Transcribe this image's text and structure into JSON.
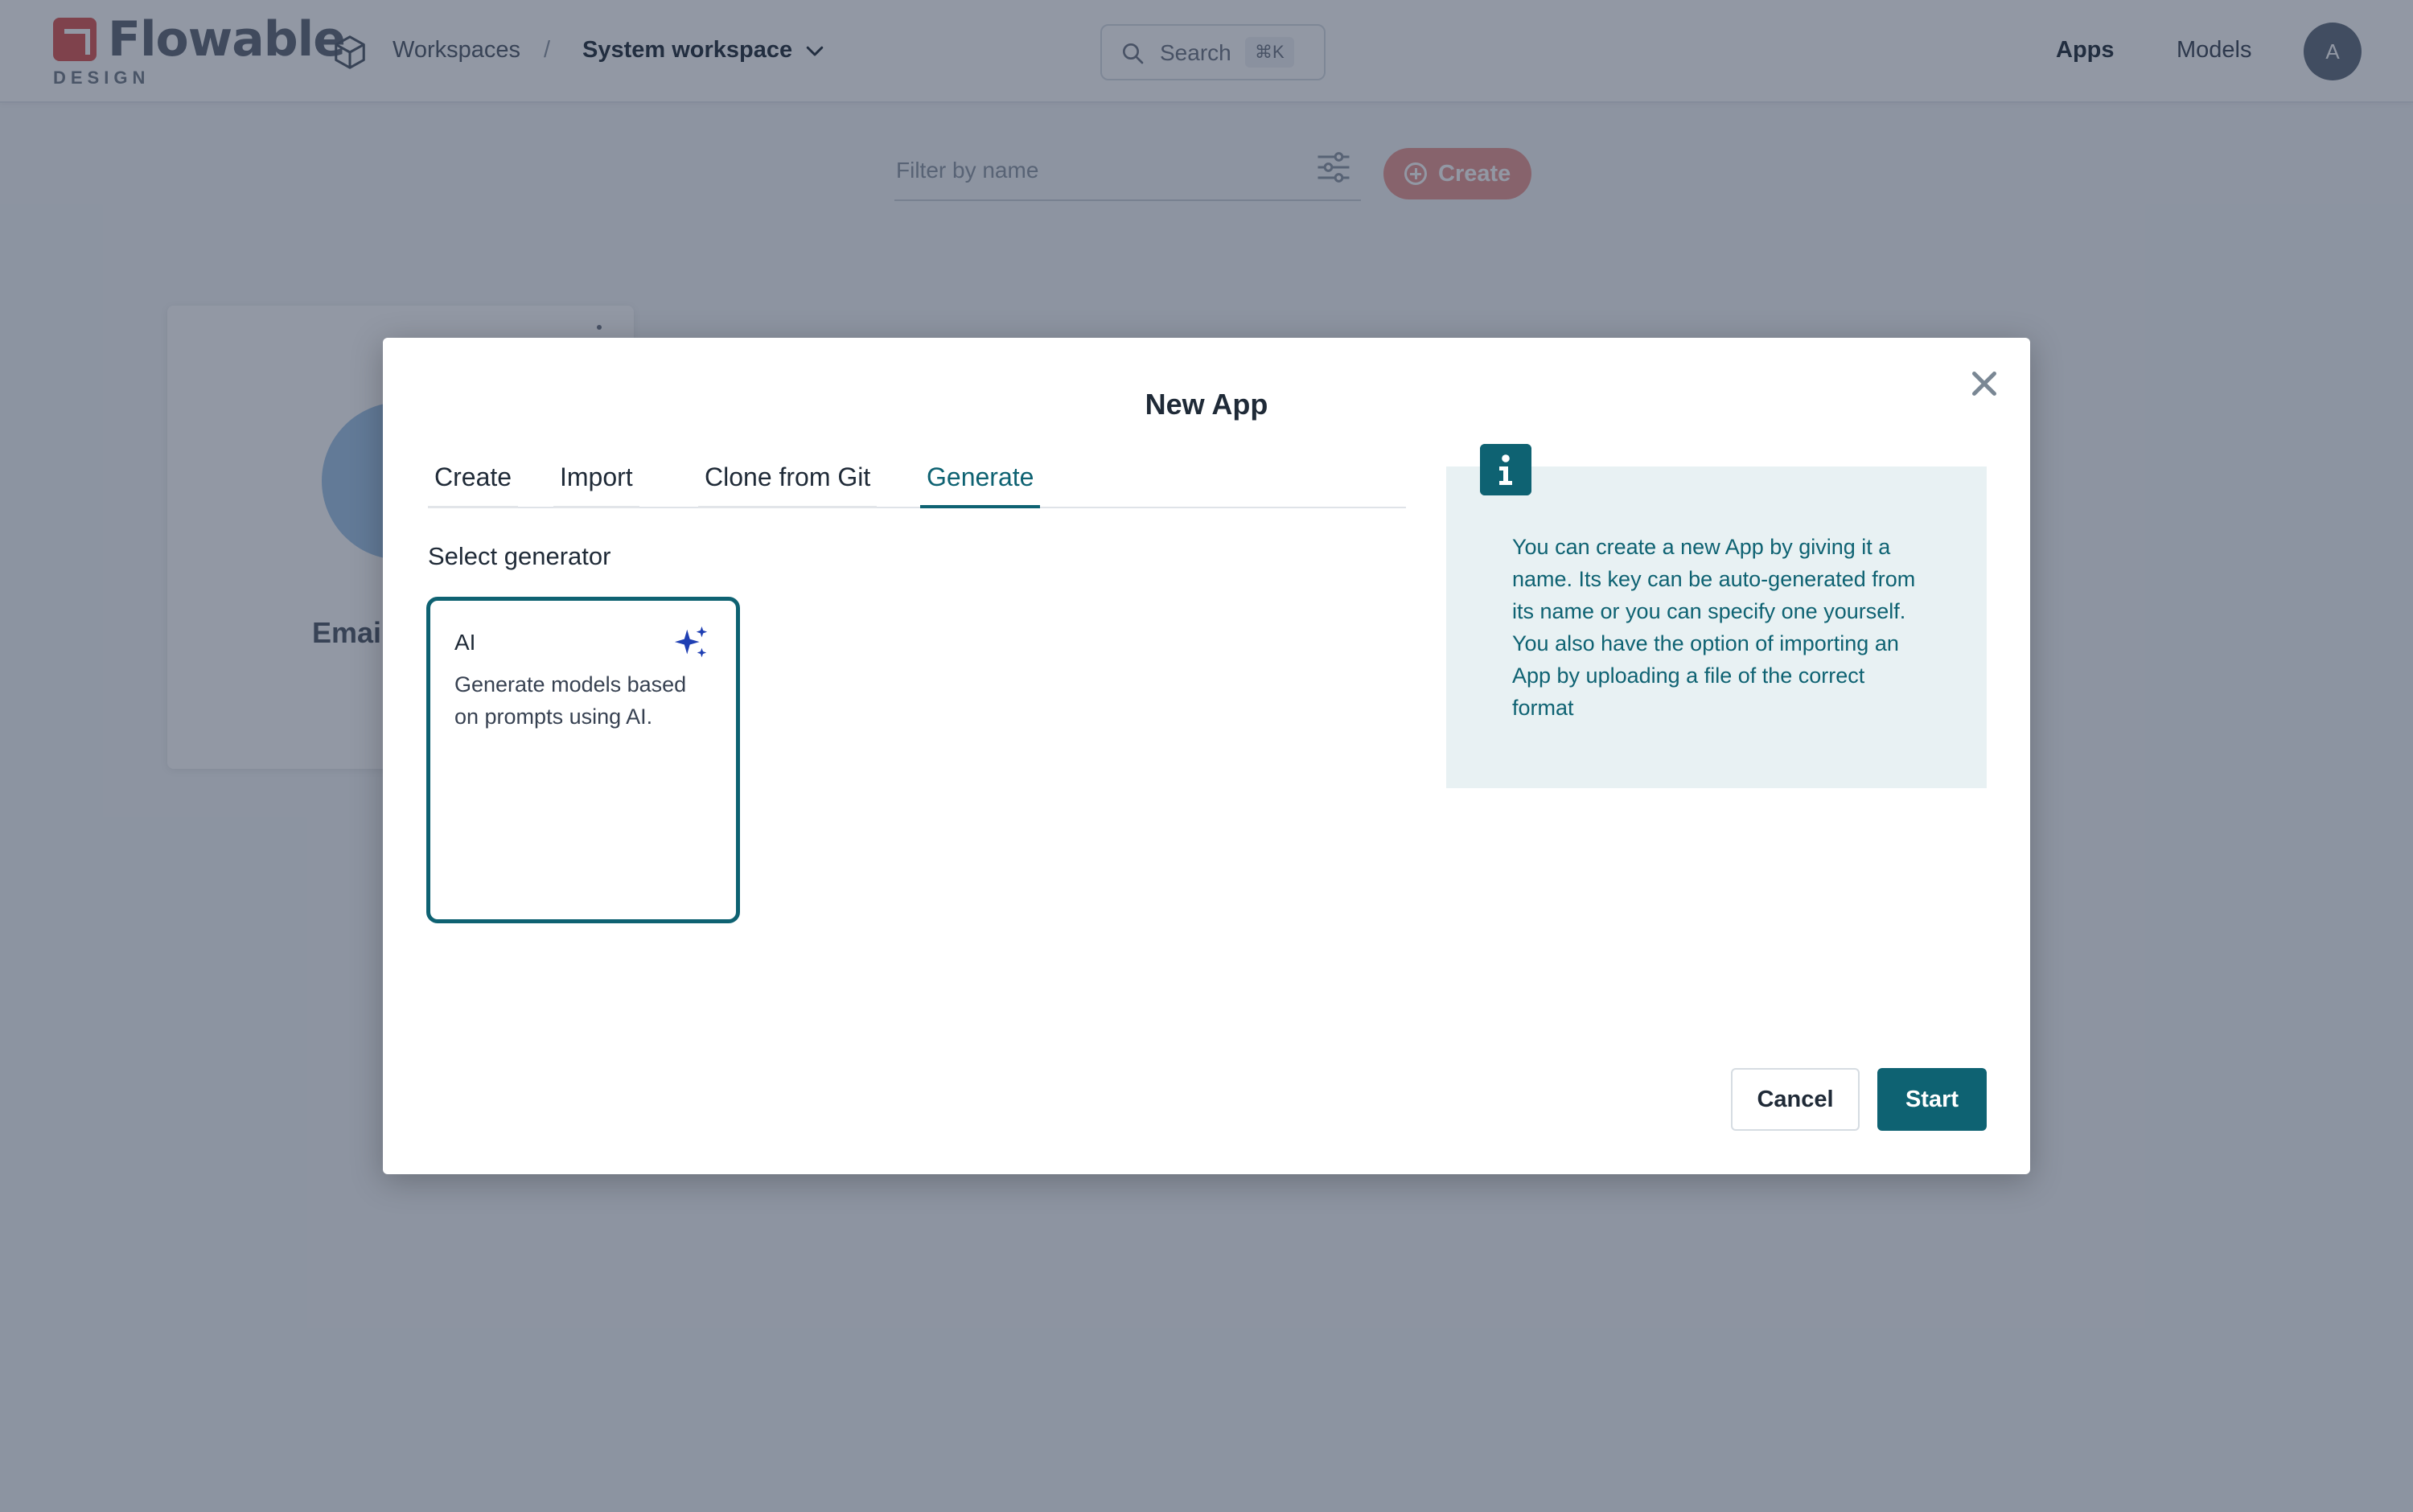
{
  "topbar": {
    "logo_word": "Flowable",
    "logo_sub": "DESIGN",
    "breadcrumb": {
      "workspaces": "Workspaces",
      "separator": "/",
      "current": "System workspace"
    },
    "search": {
      "placeholder": "Search",
      "shortcut": "⌘K"
    },
    "nav": {
      "apps": "Apps",
      "models": "Models"
    },
    "avatar_initial": "A"
  },
  "toolbar": {
    "filter_placeholder": "Filter by name",
    "create_label": "Create"
  },
  "background_card": {
    "name": "Emai"
  },
  "modal": {
    "title": "New App",
    "tabs": [
      {
        "label": "Create",
        "active": false
      },
      {
        "label": "Import",
        "active": false
      },
      {
        "label": "Clone from Git",
        "active": false
      },
      {
        "label": "Generate",
        "active": true
      }
    ],
    "select_label": "Select generator",
    "generator": {
      "title": "AI",
      "description": "Generate models based on prompts using AI.",
      "icon": "sparkle-icon"
    },
    "info": {
      "icon": "info-icon",
      "text": "You can create a new App by giving it a name. Its key can be auto-generated from its name or you can specify one yourself. You also have the option of importing an App by uploading a file of the correct format"
    },
    "buttons": {
      "cancel": "Cancel",
      "start": "Start"
    }
  },
  "colors": {
    "accent": "#0e6272",
    "brand": "#d9534f",
    "sparkle": "#1f3fb3",
    "overlay": "rgba(37,50,74,0.5)"
  }
}
